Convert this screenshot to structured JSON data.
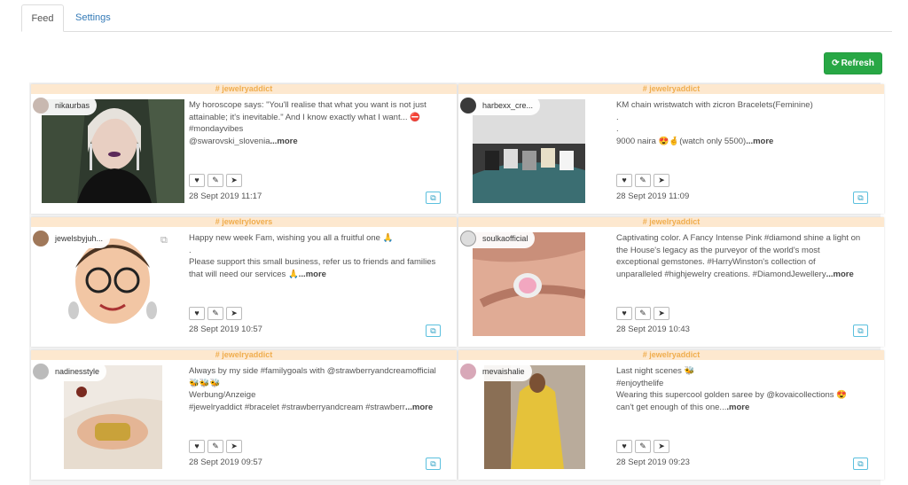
{
  "tabs": [
    {
      "label": "Feed",
      "active": true
    },
    {
      "label": "Settings",
      "active": false
    }
  ],
  "refresh": {
    "label": "Refresh",
    "icon": "refresh-icon"
  },
  "actions_icons": [
    "heart-icon",
    "comment-icon",
    "send-icon"
  ],
  "copy_icon": "copy-icon",
  "colors": {
    "accent": "#337ab7",
    "refresh": "#28a745",
    "tag_bg": "#fde8cf",
    "tag_text": "#f0ad4e"
  },
  "posts": [
    {
      "tag": "# jewelryaddict",
      "user": "nikaurbas",
      "caption": [
        "My horoscope says: \"You'll realise that what you want is not just",
        "attainable; it's inevitable.\" And I know exactly what I want... ⛔",
        "#mondayvibes",
        "@swarovski_slovenia"
      ],
      "more": "...more",
      "date": "28 Sept 2019 11:17"
    },
    {
      "tag": "# jewelryaddict",
      "user": "harbexx_cre...",
      "caption": [
        "KM chain wristwatch with zicron Bracelets(Feminine)",
        ".",
        ".",
        "9000 naira 😍🤞(watch only 5500)"
      ],
      "more": "...more",
      "date": "28 Sept 2019 11:09"
    },
    {
      "tag": "# jewelrylovers",
      "user": "jewelsbyjuh...",
      "caption": [
        "Happy new week Fam, wishing you all a fruitful one 🙏",
        ".",
        "Please support this small business,  refer us to friends and families",
        "that will need our services 🙏"
      ],
      "more": "...more",
      "date": "28 Sept 2019 10:57"
    },
    {
      "tag": "# jewelryaddict",
      "user": "soulkaofficial",
      "caption": [
        "Captivating color. A Fancy Intense Pink #diamond shine a light on",
        "the House's legacy as the purveyor of the world's most",
        "exceptional gemstones. #HarryWinston's collection of",
        "unparalleled #highjewelry creations. #DiamondJewellery"
      ],
      "more": "...more",
      "date": "28 Sept 2019 10:43"
    },
    {
      "tag": "# jewelryaddict",
      "user": "nadinesstyle",
      "caption": [
        "Always by my side #familygoals with @strawberryandcreamofficial",
        "🐝🐝🐝",
        "Werbung/Anzeige",
        "#jewelryaddict #bracelet #strawberryandcream #strawberr"
      ],
      "more": "...more",
      "date": "28 Sept 2019 09:57"
    },
    {
      "tag": "# jewelryaddict",
      "user": "mevaishalie",
      "caption": [
        "Last night scenes 🐝",
        "#enjoythelife",
        "Wearing this supercool golden saree by @kovaicollections 😍",
        "can't get enough of this one..."
      ],
      "more": ".more",
      "date": "28 Sept 2019 09:23"
    }
  ]
}
